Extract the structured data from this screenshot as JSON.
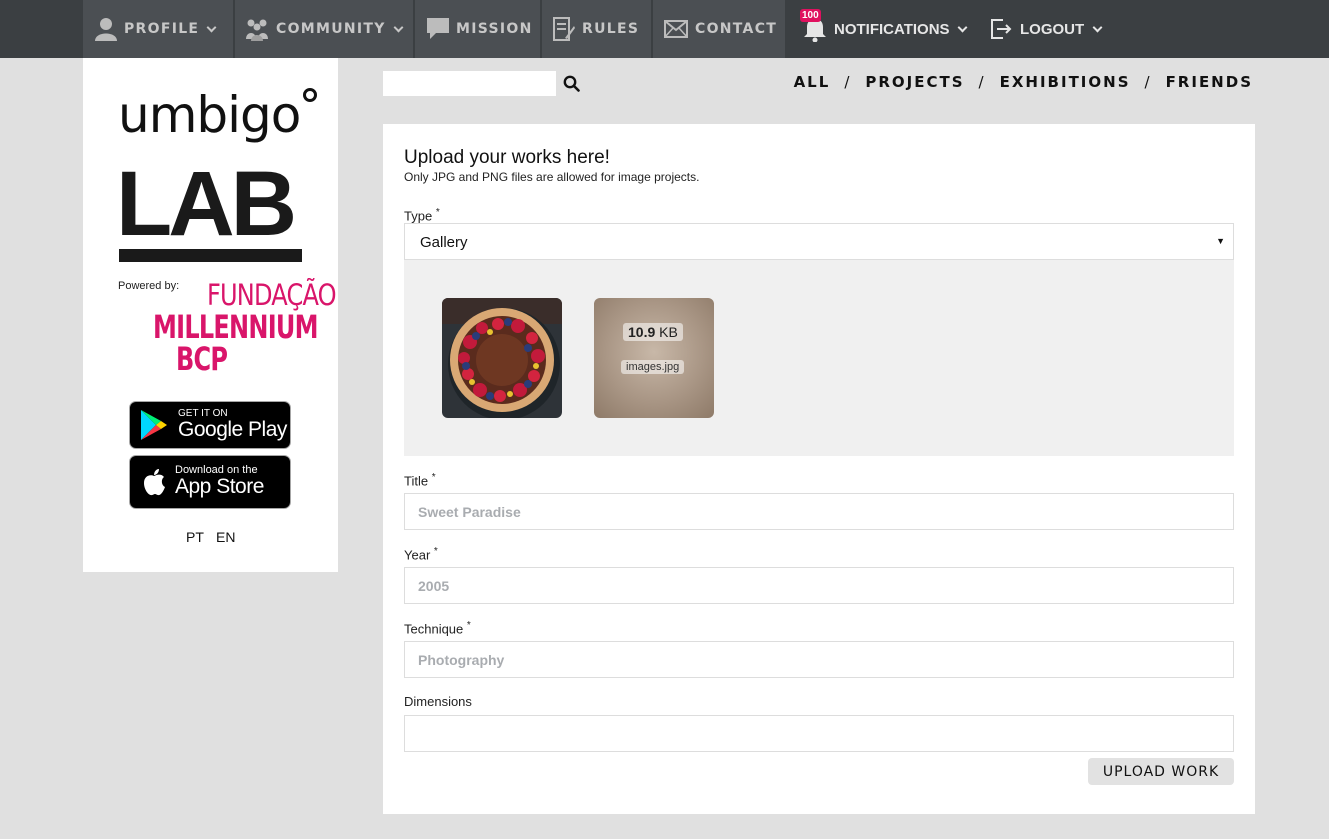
{
  "nav": {
    "profile": "PROFILE",
    "community": "COMMUNITY",
    "mission": "MISSION",
    "rules": "RULES",
    "contact": "CONTACT",
    "notifications": "NOTIFICATIONS",
    "notifications_count": "100",
    "logout": "LOGOUT",
    "icons": [
      "user-icon",
      "community-icon",
      "speech-bubble-icon",
      "rules-icon",
      "envelope-icon",
      "bell-icon",
      "logout-icon"
    ]
  },
  "sidebar": {
    "logo_top": "umbigo",
    "logo_main": "LAB",
    "powered_by": "Powered by:",
    "sponsor_line1": "FUNDAÇÃO",
    "sponsor_line2": "MILLENNIUM",
    "sponsor_line3": "BCP",
    "google_play_small": "GET IT ON",
    "google_play_big": "Google Play",
    "app_store_small": "Download on the",
    "app_store_big": "App Store",
    "languages": [
      "PT",
      "EN"
    ]
  },
  "search": {
    "placeholder": ""
  },
  "filters": [
    "ALL",
    "PROJECTS",
    "EXHIBITIONS",
    "FRIENDS"
  ],
  "form": {
    "title": "Upload your works here!",
    "subtitle": "Only JPG and PNG files are allowed for image projects.",
    "type_label": "Type",
    "type_value": "Gallery",
    "required_mark": "*",
    "preview": {
      "size_value": "10.9",
      "size_unit": "KB",
      "filename": "images.jpg"
    },
    "title_label": "Title",
    "title_placeholder": "Sweet Paradise",
    "year_label": "Year",
    "year_placeholder": "2005",
    "technique_label": "Technique",
    "technique_placeholder": "Photography",
    "dimensions_label": "Dimensions",
    "dimensions_placeholder": "",
    "submit": "UPLOAD WORK"
  },
  "colors": {
    "nav_bg": "#3b3f42",
    "nav_active": "#4b4f53",
    "accent": "#d9156a",
    "page_bg": "#e0e0e0"
  }
}
